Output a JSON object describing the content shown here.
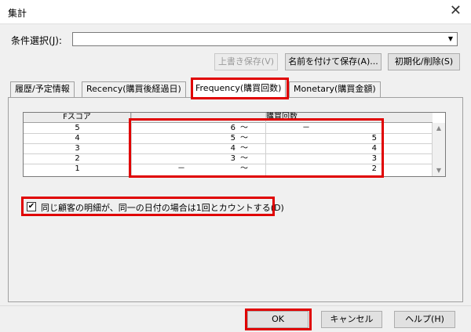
{
  "window": {
    "title": "集計",
    "close": "✕"
  },
  "condition": {
    "label": "条件選択(",
    "mnemonic": "J",
    "label_end": "):",
    "value": ""
  },
  "buttons": {
    "overwrite_save": "上書き保存(V)",
    "save_as": "名前を付けて保存(A)...",
    "reset_delete": "初期化/削除(S)",
    "ok": "OK",
    "cancel": "キャンセル",
    "help": "ヘルプ(H)"
  },
  "tabs": [
    {
      "label": "履歴/予定情報"
    },
    {
      "label": "Recency(購買後経過日)"
    },
    {
      "label": "Frequency(購買回数)"
    },
    {
      "label": "Monetary(購買金額)"
    }
  ],
  "grid": {
    "headers": {
      "score": "Fスコア",
      "count": "購買回数"
    },
    "rows": [
      {
        "score": "5",
        "from": "6",
        "sep": "〜",
        "to": "－"
      },
      {
        "score": "4",
        "from": "5",
        "sep": "〜",
        "to": "5"
      },
      {
        "score": "3",
        "from": "4",
        "sep": "〜",
        "to": "4"
      },
      {
        "score": "2",
        "from": "3",
        "sep": "〜",
        "to": "3"
      },
      {
        "score": "1",
        "from": "－",
        "sep": "〜",
        "to": "2"
      }
    ]
  },
  "checkbox": {
    "label": "同じ顧客の明細が、同一の日付の場合は1回とカウントする(D)",
    "checked": true,
    "mark": "✔"
  },
  "colors": {
    "highlight": "#e00000"
  }
}
